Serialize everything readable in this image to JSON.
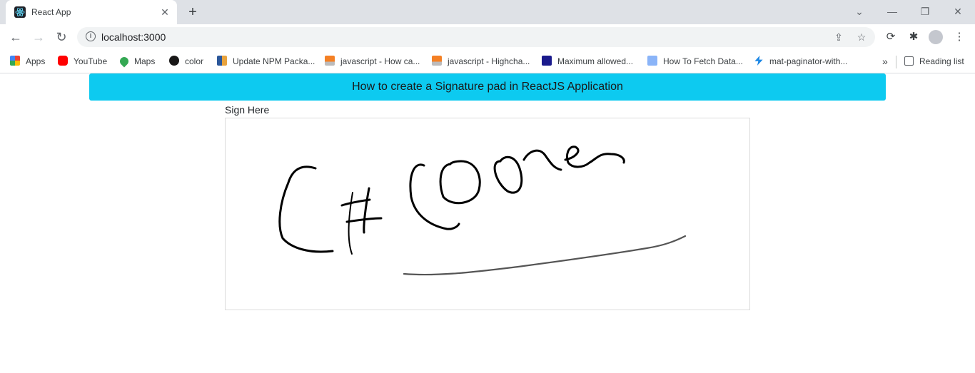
{
  "browser": {
    "tab_title": "React App",
    "tab_close": "✕",
    "new_tab": "+",
    "url": "localhost:3000",
    "window_controls": {
      "minimize": "—",
      "restore": "❐",
      "close": "✕"
    }
  },
  "bookmarks": [
    {
      "label": "Apps",
      "icon": "apps-icon",
      "color": "#4285f4"
    },
    {
      "label": "YouTube",
      "icon": "youtube-icon",
      "color": "#ff0000"
    },
    {
      "label": "Maps",
      "icon": "maps-icon",
      "color": "#34a853"
    },
    {
      "label": "color",
      "icon": "github-icon",
      "color": "#181717"
    },
    {
      "label": "Update NPM Packa...",
      "icon": "npm-icon",
      "color": "#2b579a"
    },
    {
      "label": "javascript - How ca...",
      "icon": "stackoverflow-icon",
      "color": "#f48024"
    },
    {
      "label": "javascript - Highcha...",
      "icon": "stackoverflow-icon",
      "color": "#f48024"
    },
    {
      "label": "Maximum allowed...",
      "icon": "p2n-icon",
      "color": "#1a1a8c"
    },
    {
      "label": "How To Fetch Data...",
      "icon": "page-icon",
      "color": "#8ab4f8"
    },
    {
      "label": "mat-paginator-with...",
      "icon": "bolt-icon",
      "color": "#1e88e5"
    }
  ],
  "bookmarks_overflow": "»",
  "reading_list": "Reading list",
  "page": {
    "banner_title": "How to create a Signature pad in ReactJS Application",
    "sign_label": "Sign Here"
  },
  "colors": {
    "banner": "#0dcaf0",
    "tabstrip": "#dee1e6"
  }
}
